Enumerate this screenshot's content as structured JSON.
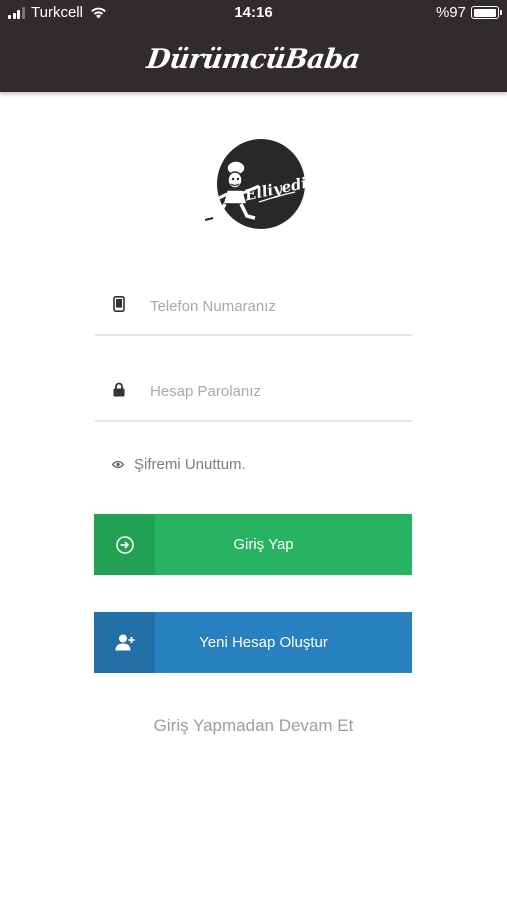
{
  "status_bar": {
    "carrier": "Turkcell",
    "time": "14:16",
    "battery": "%97",
    "battery_level": 0.97
  },
  "nav": {
    "title": "DürümcüBaba"
  },
  "logo": {
    "text": "Elliyedi"
  },
  "form": {
    "phone_placeholder": "Telefon Numaranız",
    "phone_icon": "phone-icon",
    "password_placeholder": "Hesap Parolanız",
    "password_icon": "lock-icon",
    "forgot_label": "Şifremi Unuttum.",
    "forgot_icon": "eye-icon"
  },
  "buttons": {
    "login_label": "Giriş Yap",
    "login_icon": "sign-in-icon",
    "register_label": "Yeni Hesap Oluştur",
    "register_icon": "add-user-icon"
  },
  "guest_label": "Giriş Yapmadan Devam Et",
  "colors": {
    "header_bg": "#2f2c2b",
    "login_green": "#27b361",
    "register_blue": "#2980be"
  }
}
